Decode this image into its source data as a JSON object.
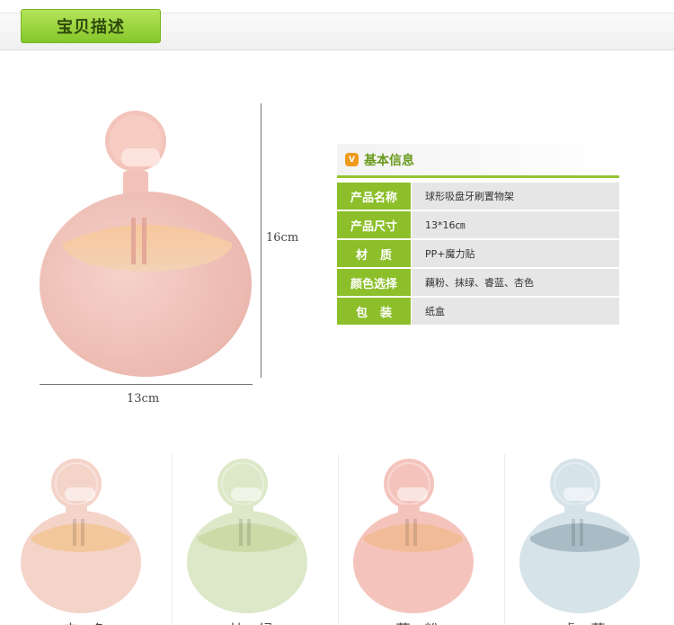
{
  "header": {
    "tab_label": "宝贝描述"
  },
  "main_product": {
    "height_label": "16cm",
    "width_label": "13cm",
    "color": "#f2c8bf"
  },
  "info": {
    "icon_text": "V",
    "title": "基本信息",
    "rows": [
      {
        "key": "产品名称",
        "value": "球形吸盘牙刷置物架"
      },
      {
        "key": "产品尺寸",
        "value": "13*16㎝"
      },
      {
        "key": "材质",
        "value": "PP+魔力贴"
      },
      {
        "key": "颜色选择",
        "value": "藕粉、抹绿、睿蓝、杏色"
      },
      {
        "key": "包装",
        "value": "纸盒"
      }
    ]
  },
  "variants": [
    {
      "label": "杏色",
      "body_color": "#f4d3c9",
      "inner_color": "#f2c79b"
    },
    {
      "label": "抹绿",
      "body_color": "#dce8c7",
      "inner_color": "#cbdba8"
    },
    {
      "label": "藕粉",
      "body_color": "#f4c4bc",
      "inner_color": "#f2bb98"
    },
    {
      "label": "睿蓝",
      "body_color": "#d6e3e9",
      "inner_color": "#a9bcc6"
    }
  ]
}
